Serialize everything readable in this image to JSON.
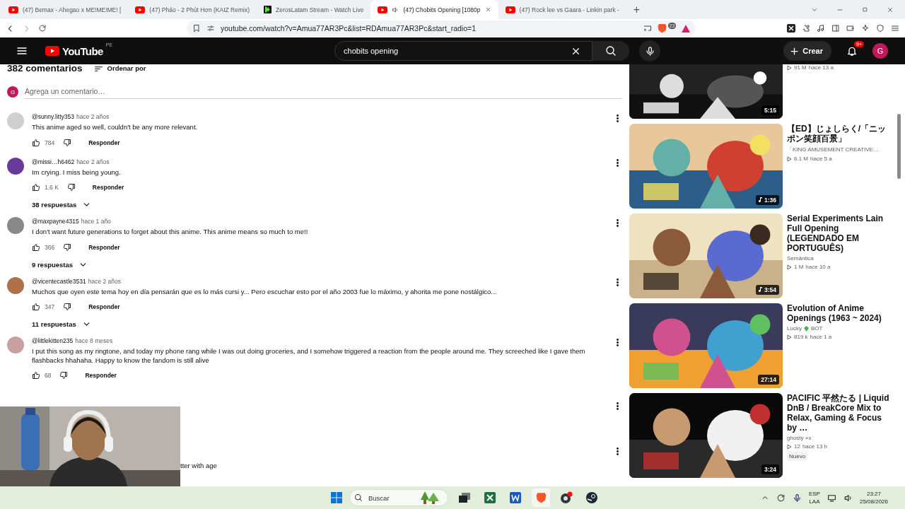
{
  "browser": {
    "tabs": [
      {
        "title": "(47) Bemax - Ahegao x ME!ME!ME! [",
        "kind": "youtube",
        "audio": false,
        "selected": false
      },
      {
        "title": "(47) Pháo - 2 Phút Hơn (KAIZ Remix)",
        "kind": "youtube",
        "audio": false,
        "selected": false
      },
      {
        "title": "ZerosLatam Stream - Watch Live",
        "kind": "kick",
        "audio": false,
        "selected": false
      },
      {
        "title": "(47) Chobits Opening [1080p",
        "kind": "youtube",
        "audio": true,
        "selected": true
      },
      {
        "title": "(47) Rock lee vs Gaara - Linkin park -",
        "kind": "youtube",
        "audio": false,
        "selected": false
      }
    ],
    "new_tab": "+",
    "url": "youtube.com/watch?v=Amua77AR3Pc&list=RDAmua77AR3Pc&start_radio=1",
    "brave_badge": "23"
  },
  "youtube": {
    "logo": "YouTube",
    "region": "PE",
    "search": {
      "value": "chobits opening"
    },
    "create": "Crear",
    "notifications": "9+",
    "avatar": "G"
  },
  "comments": {
    "count": "382 comentarios",
    "sort": "Ordenar por",
    "add": {
      "avatar": "G",
      "placeholder": "Agrega un comentario…"
    },
    "items": [
      {
        "kind": "full",
        "author": "@sunny.litty353",
        "time": "hace 2 años",
        "text": "This anime aged so well, couldn't be any more relevant.",
        "likes": "784",
        "reply": "Responder"
      },
      {
        "kind": "full",
        "author": "@missi…h6462",
        "time": "hace 2 años",
        "text": "Im crying. I miss being young.",
        "likes": "1.6 K",
        "reply": "Responder",
        "replies": "38 respuestas"
      },
      {
        "kind": "full",
        "author": "@maxpayne4315",
        "time": "hace 1 año",
        "text": "I don't want future generations to forget about this anime. This anime means so much to me!!",
        "likes": "366",
        "reply": "Responder",
        "replies": "9 respuestas"
      },
      {
        "kind": "full",
        "author": "@vicentecastle3531",
        "time": "hace 2 años",
        "text": "Muchos que oyen este tema hoy en día pensarán que es lo más cursi y... Pero escuchar esto por el año 2003 fue lo máximo, y ahorita me pone nostálgico...",
        "likes": "347",
        "reply": "Responder",
        "replies": "11 respuestas"
      },
      {
        "kind": "full",
        "author": "@littlekitten235",
        "time": "hace 8 meses",
        "text": "I put this song as my ringtone, and today my phone rang while I was out doing groceries, and I somehow triggered a reaction from the people around me. They screeched like I gave them flashbacks hhahaha. Happy to know the fandom is still alive",
        "likes": "68",
        "reply": "Responder"
      },
      {
        "kind": "hidden"
      },
      {
        "kind": "hidden",
        "text": "tter with age"
      }
    ]
  },
  "related": [
    {
      "kind": "partial",
      "views": "91 M",
      "age": "hace 13 a"
    },
    {
      "kind": "full",
      "duration": "1:36",
      "music": true,
      "title": "【ED】じょしらく/「ニッポン笑顔百景」",
      "channel": "「KING AMUSEMENT CREATIVE…",
      "views": "6.1 M",
      "age": "hace 5 a"
    },
    {
      "kind": "full",
      "duration": "3:54",
      "music": true,
      "title": "Serial Experiments Lain Full Opening (LEGENDADO EM PORTUGUÊS)",
      "channel": "Semântica",
      "views": "1 M",
      "age": "hace 10 a"
    },
    {
      "kind": "full",
      "duration": "27:14",
      "music": false,
      "title": "Evolution of Anime Openings (1963 ~ 2024)",
      "channel": "Lucky",
      "channel_tag": "BOT",
      "views": "819 k",
      "age": "hace 1 a"
    },
    {
      "kind": "full",
      "duration": "3:24",
      "music": false,
      "title": "PACIFIC 平然たる | Liquid DnB / BreakCore Mix to Relax, Gaming & Focus by …",
      "channel": "ghosty ×x",
      "views": "12",
      "age": "hace 13 h",
      "badge": "Nuevo"
    }
  ],
  "first_duration": "5:15",
  "taskbar": {
    "search": {
      "placeholder": "Buscar"
    },
    "lang": "ESP",
    "layout": "LAA",
    "time": "23:27",
    "date": "25/08/2026"
  }
}
